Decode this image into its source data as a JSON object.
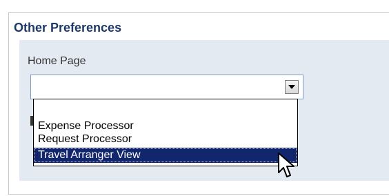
{
  "section": {
    "title": "Other Preferences"
  },
  "field": {
    "label": "Home Page",
    "value": ""
  },
  "dropdown": {
    "options": [
      "",
      "Expense Processor",
      "Request Processor",
      "Travel Arranger View"
    ],
    "highlighted_index": 3
  },
  "colors": {
    "title": "#1f3a68",
    "panel_bg": "#e4eaf2",
    "selection_bg": "#12266e",
    "select_border": "#7a9cc6"
  },
  "icons": {
    "dropdown": "chevron-down-icon",
    "cursor": "pointer-cursor-icon"
  }
}
